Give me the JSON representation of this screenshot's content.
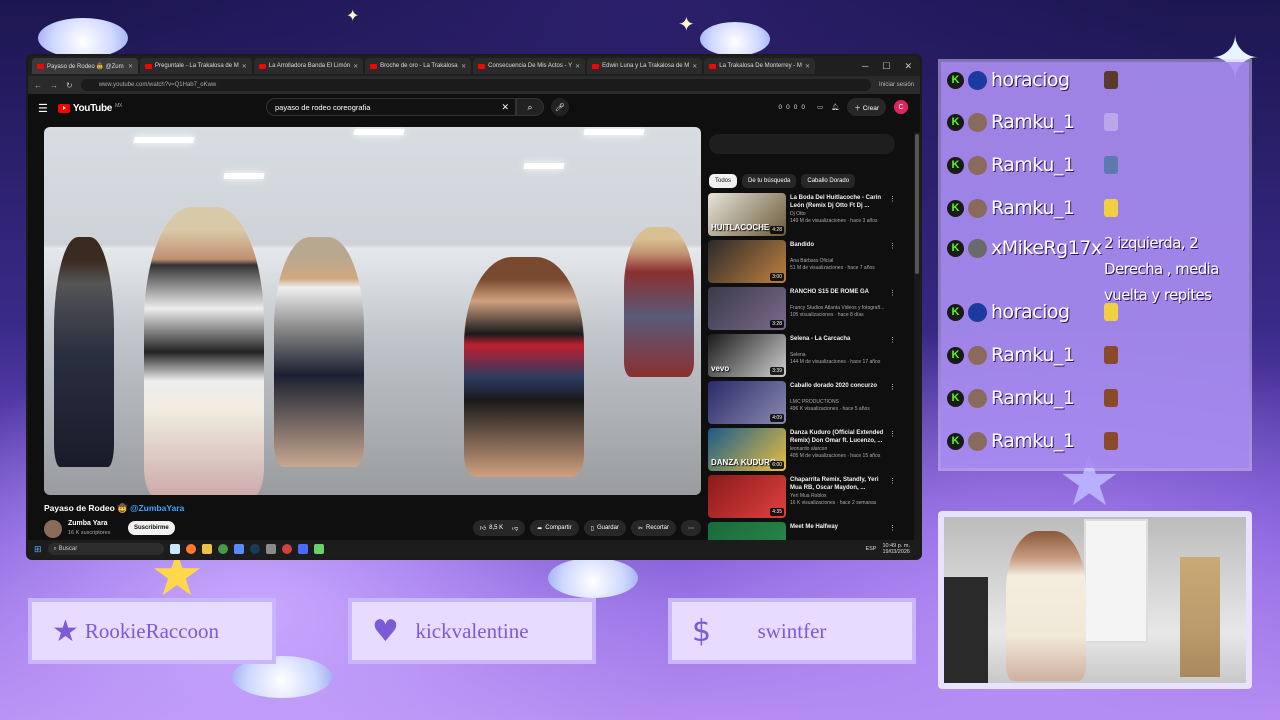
{
  "browser": {
    "tabs": [
      {
        "label": "Payaso de Rodeo 🤠 @Zum",
        "active": true
      },
      {
        "label": "Preguntale - La Trakalosa de M"
      },
      {
        "label": "La Arrolladora Banda El Limón"
      },
      {
        "label": "Broche de oro - La Trakalosa"
      },
      {
        "label": "Consecuencia De Mis Actos - Y"
      },
      {
        "label": "Edwin Luna y La Trakalosa de M"
      },
      {
        "label": "La Trakalosa De Monterrey - M"
      }
    ],
    "url": "www.youtube.com/watch?v=Q1Hab7_oKww",
    "signin": "Iniciar sesión"
  },
  "youtube": {
    "logo_text": "YouTube",
    "logo_region": "MX",
    "search_query": "payaso de rodeo coreografia",
    "header_counts": [
      "0",
      "0",
      "0",
      "0"
    ],
    "create_label": "Crear",
    "avatar_letter": "C",
    "video_title_prefix": "Payaso de Rodeo 🤠 ",
    "video_title_handle": "@ZumbaYara",
    "channel_name": "Zumba Yara",
    "channel_subs": "16 K suscriptores",
    "subscribe_label": "Suscribirme",
    "likes": "8,5 K",
    "share_label": "Compartir",
    "save_label": "Guardar",
    "clip_label": "Recortar",
    "chips": [
      "Todos",
      "De tu búsqueda",
      "Caballo Dorado"
    ],
    "recommendations": [
      {
        "title": "La Boda Del Huitlacoche - Carin León (Remix Dj Otto Ft Dj ...",
        "channel": "Dj Otto",
        "meta": "149 M de visualizaciones · hace 3 años",
        "duration": "4:28",
        "thumb_text": "HUITLACOCHE",
        "colors": [
          "#e8e4d8",
          "#6a5a3a"
        ]
      },
      {
        "title": "Bandido",
        "channel": "Ana Bárbara Oficial",
        "meta": "51 M de visualizaciones · hace 7 años",
        "duration": "3:00",
        "thumb_text": "",
        "colors": [
          "#2a2a2a",
          "#c08040"
        ]
      },
      {
        "title": "RANCHO S15 DE ROME GA",
        "channel": "Francy Studios Atlanta Videos y fotografí...",
        "meta": "105 visualizaciones · hace 8 días",
        "duration": "3:28",
        "thumb_text": "",
        "colors": [
          "#3a3a4a",
          "#7a6a8a"
        ]
      },
      {
        "title": "Selena - La Carcacha",
        "channel": "Selena",
        "meta": "144 M de visualizaciones · hace 17 años",
        "duration": "3:39",
        "thumb_text": "vevo",
        "colors": [
          "#1a1a1a",
          "#d0d0d0"
        ]
      },
      {
        "title": "Caballo dorado 2020 concurzo",
        "channel": "LMC PRODUCTIONS",
        "meta": "496 K visualizaciones · hace 5 años",
        "duration": "4:09",
        "thumb_text": "",
        "colors": [
          "#2a2a6a",
          "#8a8ab0"
        ]
      },
      {
        "title": "Danza Kuduro (Official Extended Remix) Don Omar ft. Lucenzo, ...",
        "channel": "leonardo alarcon",
        "meta": "405 M de visualizaciones · hace 15 años",
        "duration": "6:00",
        "thumb_text": "DANZA KUDURO",
        "colors": [
          "#1a5a8a",
          "#e8c040"
        ]
      },
      {
        "title": "Chaparrita Remix, Standly, Yeri Mua RB, Oscar Maydon, ...",
        "channel": "Yeri Mua Roblox",
        "meta": "16 K visualizaciones · hace 2 semanas",
        "duration": "4:35",
        "thumb_text": "",
        "colors": [
          "#8a1a1a",
          "#e04040"
        ]
      },
      {
        "title": "Meet Me Halfway",
        "channel": "",
        "meta": "",
        "duration": "",
        "thumb_text": "",
        "colors": [
          "#1a6a3a",
          "#2a8a4a"
        ]
      }
    ]
  },
  "taskbar": {
    "search_placeholder": "Buscar",
    "lang": "ESP",
    "time": "10:49 p. m.",
    "date": "19/03/2026"
  },
  "chat": {
    "messages": [
      {
        "user": "horaciog",
        "emote_color": "#5a3a2a"
      },
      {
        "user": "Ramku_1",
        "emote_color": "#b8a8e8"
      },
      {
        "user": "Ramku_1",
        "emote_color": "#5a7ab0"
      },
      {
        "user": "Ramku_1",
        "emote_color": "#f0d040"
      },
      {
        "user": "xMikeRg17x",
        "text": "2 izquierda, 2 Derecha , media vuelta y repites"
      },
      {
        "user": "horaciog",
        "emote_color": "#f0d040"
      },
      {
        "user": "Ramku_1",
        "emote_color": "#8a4a2a"
      },
      {
        "user": "Ramku_1",
        "emote_color": "#8a4a2a"
      },
      {
        "user": "Ramku_1",
        "emote_color": "#8a4a2a"
      }
    ]
  },
  "panels": [
    {
      "icon": "★",
      "label": "RookieRaccoon",
      "icon_name": "star-icon"
    },
    {
      "icon": "♥",
      "label": "kickvalentine",
      "icon_name": "heart-icon"
    },
    {
      "icon": "$",
      "label": "swintfer",
      "icon_name": "dollar-icon"
    }
  ],
  "colors": {
    "kick_green": "#53fc18",
    "panel_purple": "#7b5bd6",
    "youtube_red": "#ff0000"
  }
}
